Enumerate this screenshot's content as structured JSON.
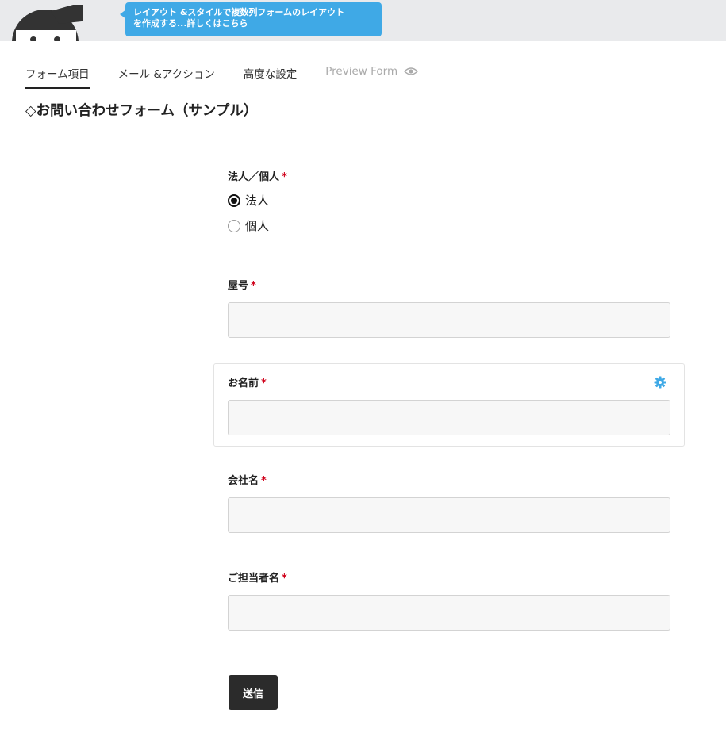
{
  "banner": {
    "line1": "レイアウト &スタイルで複数列フォームのレイアウト",
    "line2": "を作成する...詳しくはこちら"
  },
  "tabs": [
    {
      "label": "フォーム項目"
    },
    {
      "label": "メール &アクション"
    },
    {
      "label": "高度な設定"
    },
    {
      "label": "Preview Form"
    }
  ],
  "form": {
    "title": "◇お問い合わせフォーム（サンプル）",
    "required_mark": "*",
    "fields": {
      "entity_type": {
        "label": "法人／個人",
        "options": [
          {
            "label": "法人",
            "checked": true
          },
          {
            "label": "個人",
            "checked": false
          }
        ]
      },
      "trade_name": {
        "label": "屋号",
        "value": ""
      },
      "name": {
        "label": "お名前",
        "value": ""
      },
      "company": {
        "label": "会社名",
        "value": ""
      },
      "contact_person": {
        "label": "ご担当者名",
        "value": ""
      }
    },
    "submit_label": "送信"
  },
  "colors": {
    "accent": "#3fa9e6",
    "required": "#d0021b",
    "button": "#2b2b2b"
  }
}
